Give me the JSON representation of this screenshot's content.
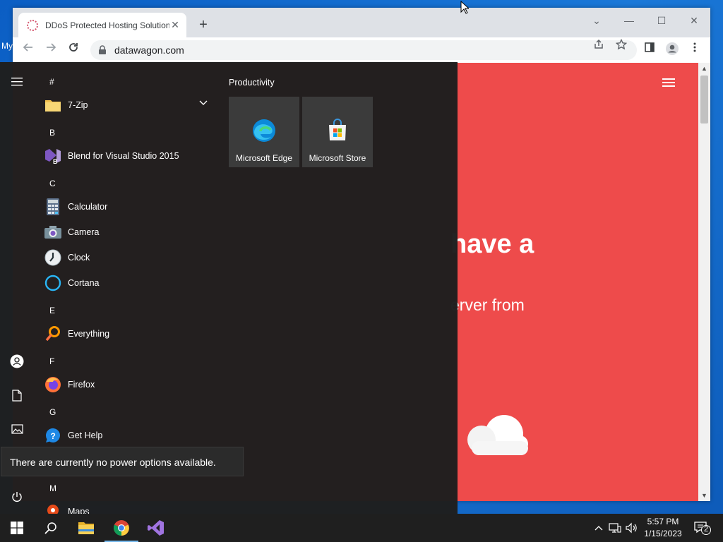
{
  "desktop": {
    "label": "My"
  },
  "browser": {
    "tab": {
      "title": "DDoS Protected Hosting Solution",
      "close": "✕"
    },
    "newtab": "+",
    "controls": {
      "dropdown": "⌄",
      "minimize": "—",
      "maximize": "☐",
      "close": "✕"
    },
    "url": "datawagon.com",
    "page": {
      "headline": "have a",
      "subline": "erver from"
    }
  },
  "start_menu": {
    "sections": [
      {
        "letter": "#",
        "apps": [
          {
            "name": "7-Zip",
            "icon": "folder-icon",
            "expandable": true
          }
        ]
      },
      {
        "letter": "B",
        "apps": [
          {
            "name": "Blend for Visual Studio 2015",
            "icon": "blend-icon"
          }
        ]
      },
      {
        "letter": "C",
        "apps": [
          {
            "name": "Calculator",
            "icon": "calculator-icon"
          },
          {
            "name": "Camera",
            "icon": "camera-icon"
          },
          {
            "name": "Clock",
            "icon": "clock-icon"
          },
          {
            "name": "Cortana",
            "icon": "cortana-icon"
          }
        ]
      },
      {
        "letter": "E",
        "apps": [
          {
            "name": "Everything",
            "icon": "magnifier-icon"
          }
        ]
      },
      {
        "letter": "F",
        "apps": [
          {
            "name": "Firefox",
            "icon": "firefox-icon"
          }
        ]
      },
      {
        "letter": "G",
        "apps": [
          {
            "name": "Get Help",
            "icon": "help-icon"
          }
        ]
      },
      {
        "letter": "M",
        "apps": [
          {
            "name": "Maps",
            "icon": "maps-icon"
          }
        ]
      }
    ],
    "tile_group": {
      "title": "Productivity",
      "tiles": [
        {
          "label": "Microsoft Edge",
          "icon": "edge-icon"
        },
        {
          "label": "Microsoft Store",
          "icon": "store-icon"
        }
      ]
    },
    "power_tooltip": "There are currently no power options available."
  },
  "taskbar": {
    "clock": {
      "time": "5:57 PM",
      "date": "1/15/2023"
    },
    "notification_count": "2"
  },
  "colors": {
    "page_accent": "#ee4b4b",
    "start_bg": "#1f1f1f",
    "taskbar_bg": "#1f1f1f"
  }
}
